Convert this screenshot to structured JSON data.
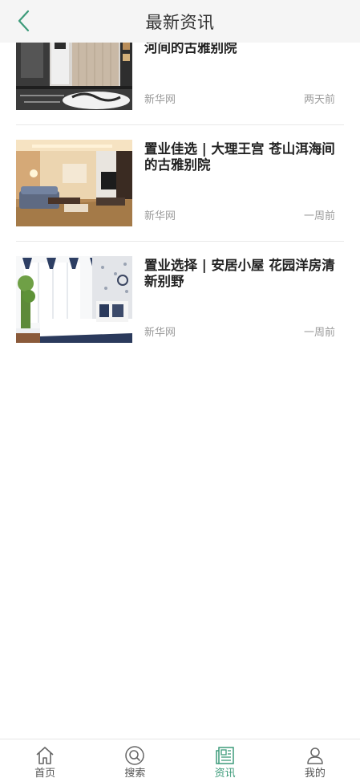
{
  "header": {
    "title": "最新资讯"
  },
  "news": [
    {
      "title": "河间的古雅别院",
      "source": "新华网",
      "time": "两天前"
    },
    {
      "title": "置业佳选 | 大理王宫 苍山洱海间的古雅别院",
      "source": "新华网",
      "time": "一周前"
    },
    {
      "title": "置业选择 | 安居小屋 花园洋房清新别野",
      "source": "新华网",
      "time": "一周前"
    }
  ],
  "tabbar": {
    "items": [
      {
        "label": "首页",
        "icon": "home-icon"
      },
      {
        "label": "搜索",
        "icon": "search-icon"
      },
      {
        "label": "资讯",
        "icon": "news-icon",
        "active": true
      },
      {
        "label": "我的",
        "icon": "user-icon"
      }
    ],
    "active_color": "#3d9b7a",
    "inactive_color": "#555555"
  },
  "colors": {
    "header_bg": "#f5f5f5",
    "back_arrow": "#3d9b7a",
    "title_text": "#222222",
    "meta_text": "#9b9b9b"
  }
}
